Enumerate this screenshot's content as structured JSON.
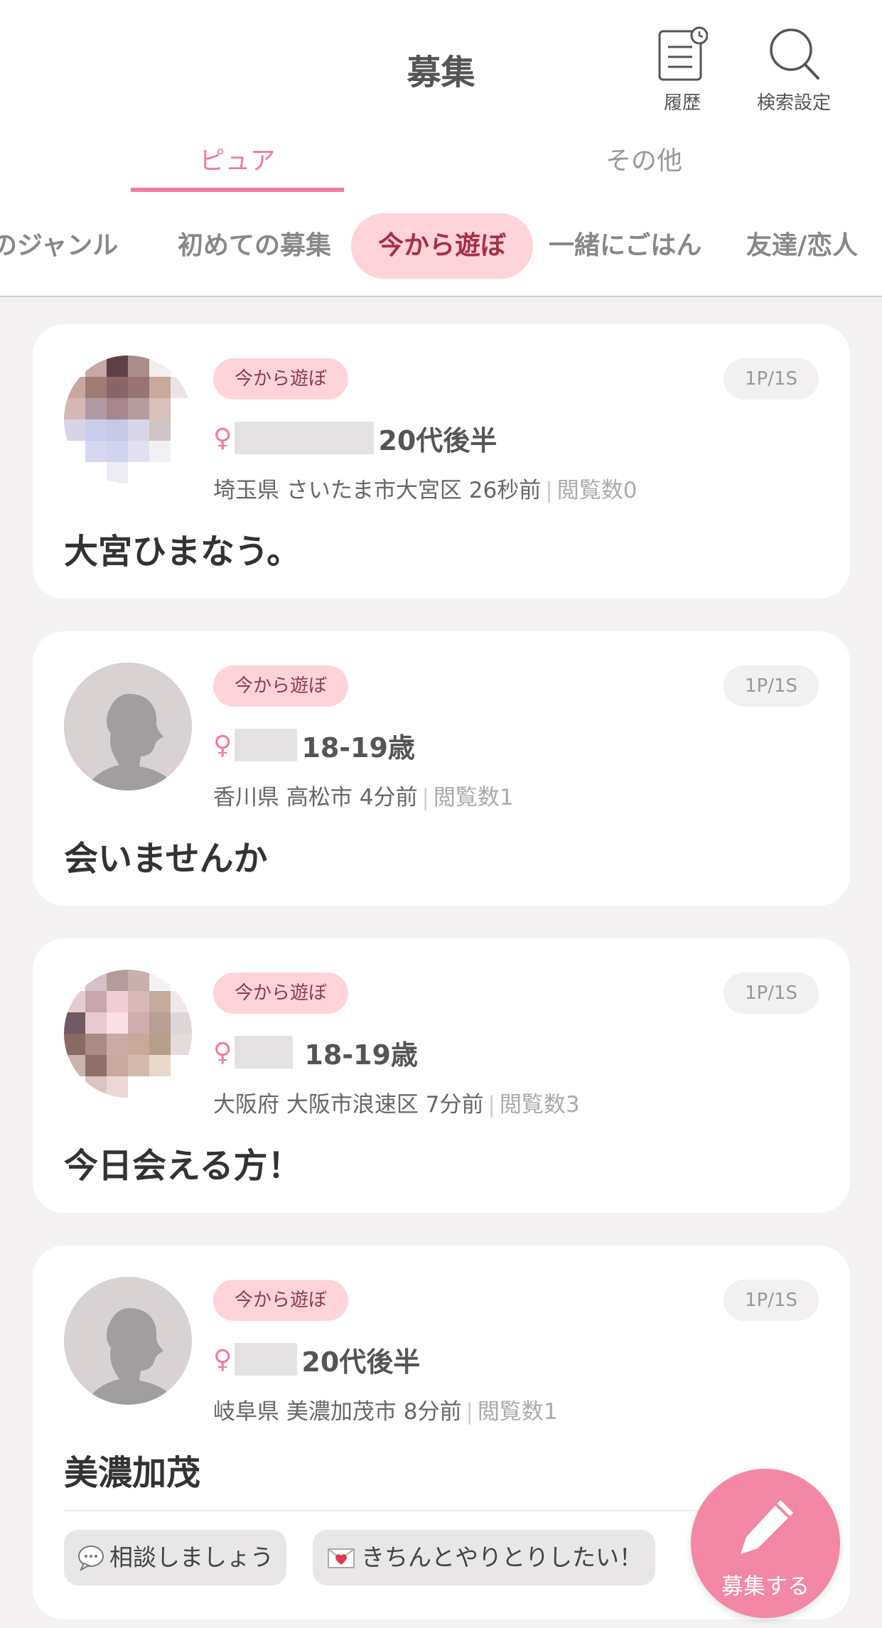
{
  "header": {
    "title": "募集",
    "history_label": "履歴",
    "search_settings_label": "検索設定"
  },
  "tabs": [
    {
      "label": "ピュア",
      "active": true
    },
    {
      "label": "その他",
      "active": false
    }
  ],
  "genres": [
    {
      "label": "のジャンル",
      "active": false
    },
    {
      "label": "初めての募集",
      "active": false
    },
    {
      "label": "今から遊ぼ",
      "active": true
    },
    {
      "label": "一緒にごはん",
      "active": false
    },
    {
      "label": "友達/恋人",
      "active": false
    }
  ],
  "posts": [
    {
      "category": "今から遊ぼ",
      "ps": "1P/1S",
      "gender": "♀",
      "age": "20代後半",
      "location": "埼玉県 さいたま市大宮区",
      "time": "26秒前",
      "views": "閲覧数0",
      "title": "大宮ひまなう。"
    },
    {
      "category": "今から遊ぼ",
      "ps": "1P/1S",
      "gender": "♀",
      "age": "18-19歳",
      "location": "香川県 高松市",
      "time": "4分前",
      "views": "閲覧数1",
      "title": "会いませんか"
    },
    {
      "category": "今から遊ぼ",
      "ps": "1P/1S",
      "gender": "♀",
      "age": "18-19歳",
      "location": "大阪府 大阪市浪速区",
      "time": "7分前",
      "views": "閲覧数3",
      "title": "今日会える方！"
    },
    {
      "category": "今から遊ぼ",
      "ps": "1P/1S",
      "gender": "♀",
      "age": "20代後半",
      "location": "岐阜県 美濃加茂市",
      "time": "8分前",
      "views": "閲覧数1",
      "title": "美濃加茂",
      "tags": [
        "相談しましょう",
        "きちんとやりとりしたい！"
      ]
    }
  ],
  "fab": {
    "label": "募集する"
  },
  "colors": {
    "accent": "#f07ca2",
    "fab": "#f387a6",
    "badge_bg": "#ffd3da",
    "badge_text": "#8d3c4c",
    "background": "#f4f2f2"
  },
  "icons": [
    "document-history-icon",
    "search-icon",
    "pencil-icon",
    "speech-bubble-icon",
    "heart-letter-icon"
  ]
}
